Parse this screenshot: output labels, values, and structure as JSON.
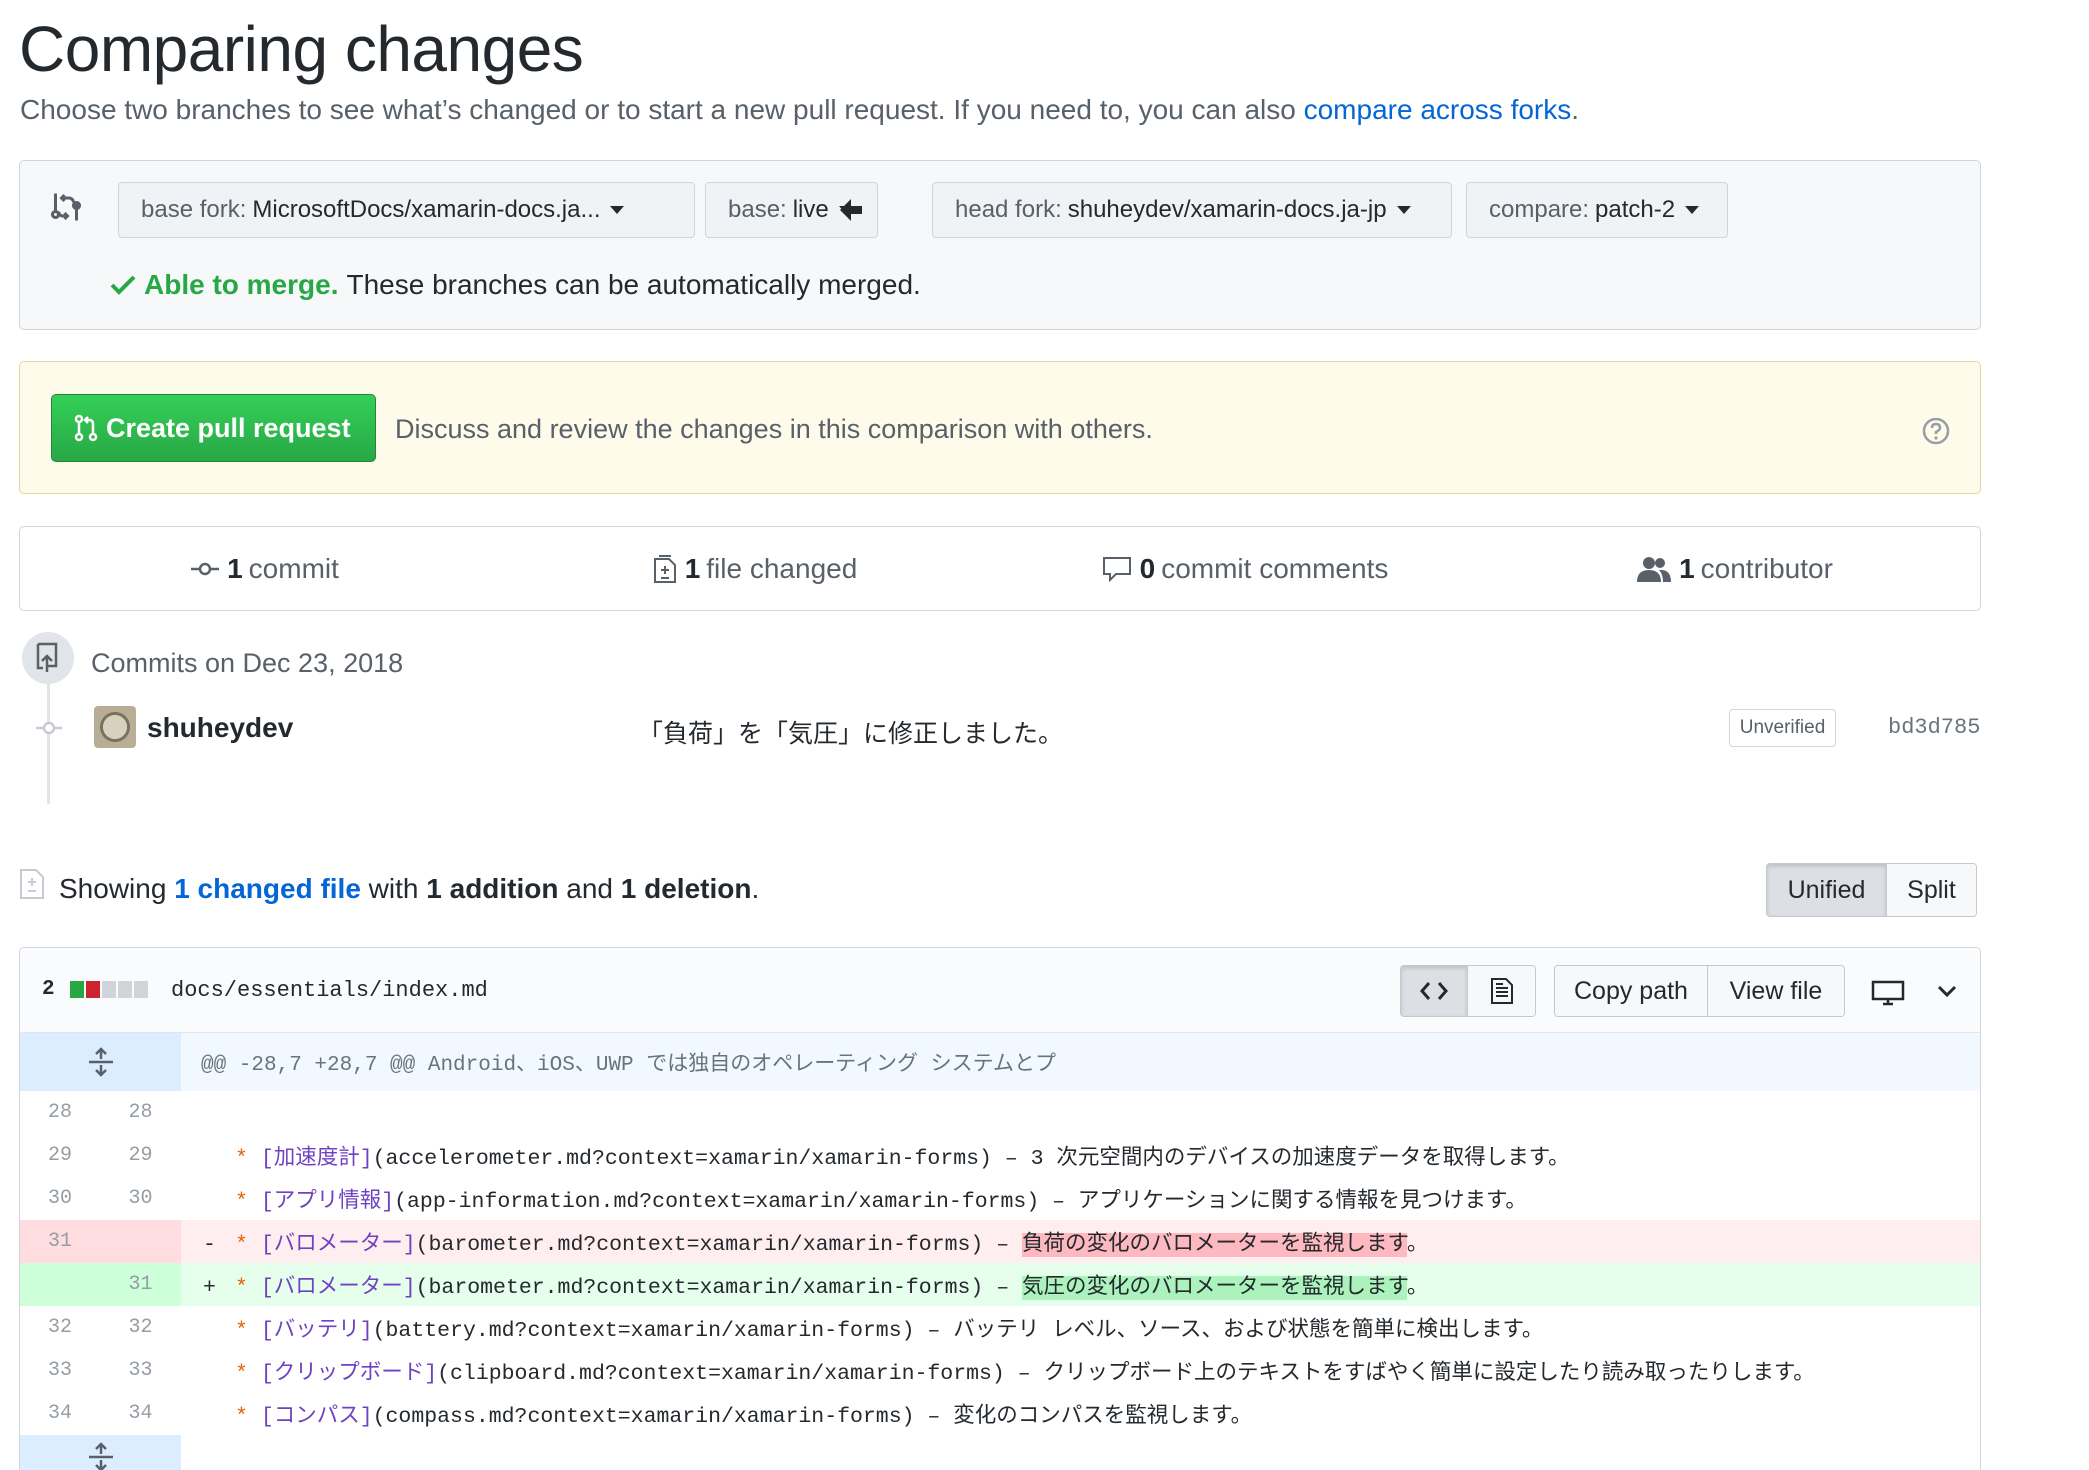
{
  "page": {
    "title": "Comparing changes",
    "subtitle": "Choose two branches to see what’s changed or to start a new pull request. If you need to, you can also ",
    "subtitle_link": "compare across forks",
    "subtitle_end": "."
  },
  "range": {
    "base_fork_label": "base fork:",
    "base_fork_value": "MicrosoftDocs/xamarin-docs.ja...",
    "base_label": "base:",
    "base_value": "live",
    "head_fork_label": "head fork:",
    "head_fork_value": "shuheydev/xamarin-docs.ja-jp",
    "compare_label": "compare:",
    "compare_value": "patch-2",
    "merge_status": "Able to merge.",
    "merge_detail": "These branches can be automatically merged."
  },
  "pull_request": {
    "button_label": "Create pull request",
    "description": "Discuss and review the changes in this comparison with others."
  },
  "numbers": {
    "commits_count": "1",
    "commits_label": "commit",
    "files_count": "1",
    "files_label": "file changed",
    "comments_count": "0",
    "comments_label": "commit comments",
    "contributors_count": "1",
    "contributors_label": "contributor"
  },
  "commits": {
    "date_heading": "Commits on Dec 23, 2018",
    "items": [
      {
        "author": "shuheydev",
        "message": "「負荷」を「気圧」に修正しました。",
        "badge": "Unverified",
        "sha": "bd3d785"
      }
    ]
  },
  "summary": {
    "prefix": "Showing ",
    "changed_link": "1 changed file",
    "mid1": " with ",
    "additions": "1 addition",
    "mid2": " and ",
    "deletions": "1 deletion",
    "suffix": ".",
    "unified_label": "Unified",
    "split_label": "Split"
  },
  "file": {
    "stat_count": "2",
    "stat_blocks": [
      "#28a745",
      "#cb2431",
      "#d1d5da",
      "#d1d5da",
      "#d1d5da"
    ],
    "path": "docs/essentials/index.md",
    "copy_path_label": "Copy path",
    "view_file_label": "View file",
    "hunk_header": "@@ -28,7 +28,7 @@ Android、iOS、UWP では独自のオペレーティング システムとプ",
    "lines": [
      {
        "old": "28",
        "new": "28",
        "sign": "",
        "type": "ctx",
        "star": "",
        "link": "",
        "rest": "",
        "hl": "",
        "tail": ""
      },
      {
        "old": "29",
        "new": "29",
        "sign": "",
        "type": "ctx",
        "star": "*",
        "link": "[加速度計]",
        "rest": "(accelerometer.md?context=xamarin/xamarin-forms) – 3 次元空間内のデバイスの加速度データを取得します。",
        "hl": "",
        "tail": ""
      },
      {
        "old": "30",
        "new": "30",
        "sign": "",
        "type": "ctx",
        "star": "*",
        "link": "[アプリ情報]",
        "rest": "(app-information.md?context=xamarin/xamarin-forms) – アプリケーションに関する情報を見つけます。",
        "hl": "",
        "tail": ""
      },
      {
        "old": "31",
        "new": "",
        "sign": "-",
        "type": "del",
        "star": "*",
        "link": "[バロメーター]",
        "rest": "(barometer.md?context=xamarin/xamarin-forms) – ",
        "hl": "負荷の変化のバロメーターを監視します",
        "tail": "。"
      },
      {
        "old": "",
        "new": "31",
        "sign": "+",
        "type": "add",
        "star": "*",
        "link": "[バロメーター]",
        "rest": "(barometer.md?context=xamarin/xamarin-forms) – ",
        "hl": "気圧の変化のバロメーターを監視します",
        "tail": "。"
      },
      {
        "old": "32",
        "new": "32",
        "sign": "",
        "type": "ctx",
        "star": "*",
        "link": "[バッテリ]",
        "rest": "(battery.md?context=xamarin/xamarin-forms) – バッテリ レベル、ソース、および状態を簡単に検出します。",
        "hl": "",
        "tail": ""
      },
      {
        "old": "33",
        "new": "33",
        "sign": "",
        "type": "ctx",
        "star": "*",
        "link": "[クリップボード]",
        "rest": "(clipboard.md?context=xamarin/xamarin-forms) – クリップボード上のテキストをすばやく簡単に設定したり読み取ったりします。",
        "hl": "",
        "tail": ""
      },
      {
        "old": "34",
        "new": "34",
        "sign": "",
        "type": "ctx",
        "star": "*",
        "link": "[コンパス]",
        "rest": "(compass.md?context=xamarin/xamarin-forms) – 変化のコンパスを監視します。",
        "hl": "",
        "tail": ""
      }
    ]
  },
  "colors": {
    "link": "#0366d6",
    "success": "#28a745",
    "deletion_bg": "#ffeef0",
    "addition_bg": "#e6ffed"
  }
}
